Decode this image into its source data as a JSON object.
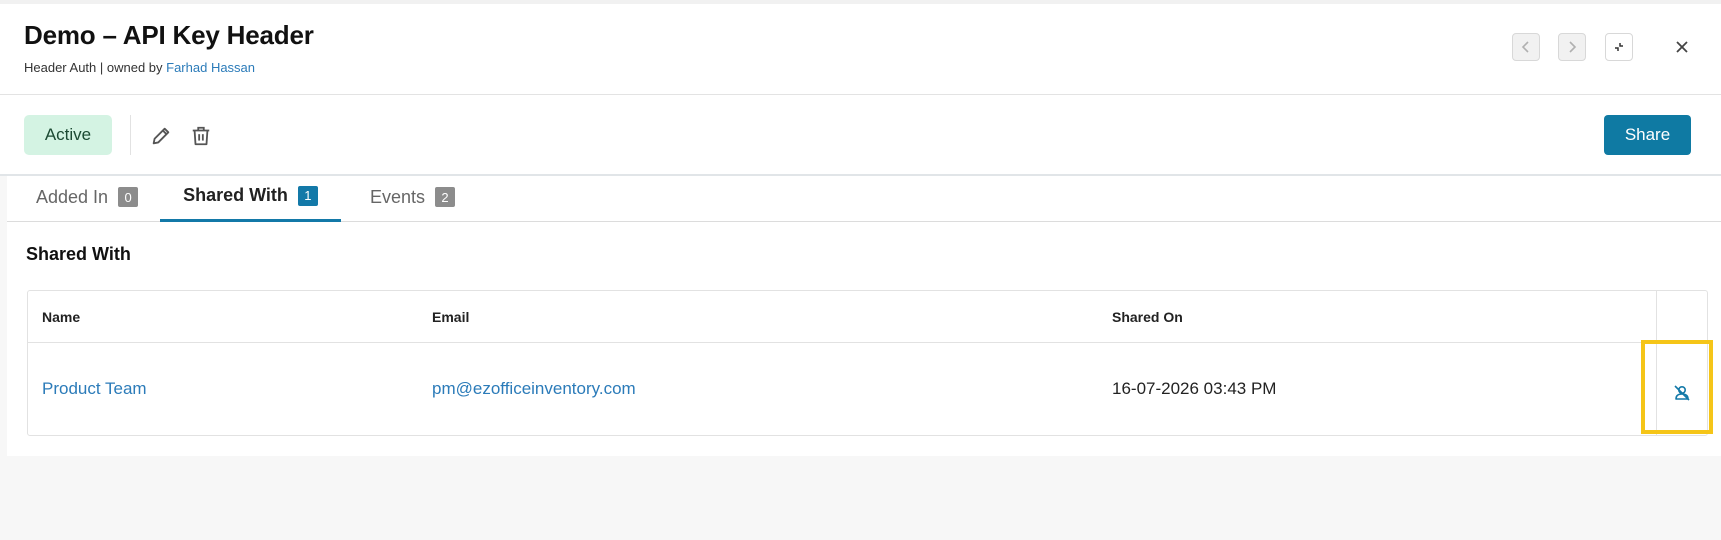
{
  "header": {
    "title": "Demo – API Key Header",
    "subtitle_prefix": "Header Auth | owned by ",
    "owner": "Farhad Hassan",
    "icons": [
      "chevron-left-icon",
      "chevron-right-icon",
      "collapse-icon",
      "close-icon"
    ]
  },
  "toolbar": {
    "status": "Active",
    "share_label": "Share",
    "icons": [
      "pencil-icon",
      "trash-icon"
    ],
    "colors": {
      "status_bg": "#d4f3e3",
      "share_bg": "#0f7aa3"
    }
  },
  "tabs": [
    {
      "label": "Added In",
      "count": "0",
      "active": false
    },
    {
      "label": "Shared With",
      "count": "1",
      "active": true
    },
    {
      "label": "Events",
      "count": "2",
      "active": false
    }
  ],
  "section": {
    "title": "Shared With"
  },
  "table": {
    "columns": [
      "Name",
      "Email",
      "Shared On"
    ],
    "rows": [
      {
        "name": "Product Team",
        "email": "pm@ezofficeinventory.com",
        "shared_on": "16-07-2026 03:43 PM",
        "action_icon": "unshare-user-icon"
      }
    ]
  },
  "colors": {
    "accent": "#1379a8",
    "link": "#2b7bb9",
    "highlight": "#f5c518"
  }
}
